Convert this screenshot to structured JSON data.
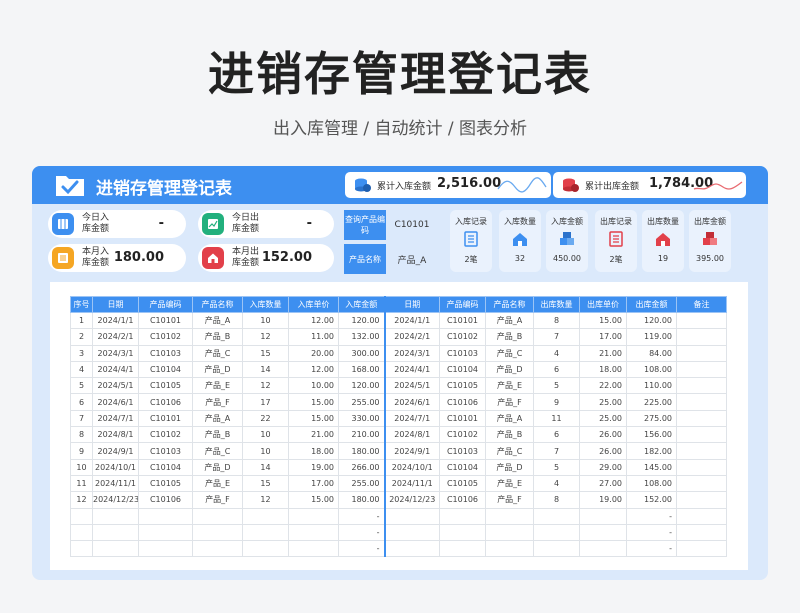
{
  "hero": {
    "title": "进销存管理登记表",
    "subtitle": "出入库管理 / 自动统计 / 图表分析"
  },
  "header": {
    "title": "进销存管理登记表",
    "in_total": {
      "label": "累计入库金额",
      "value": "2,516.00"
    },
    "out_total": {
      "label": "累计出库金额",
      "value": "1,784.00"
    }
  },
  "kpis": {
    "today_in": {
      "label": "今日入库金额",
      "value": "-"
    },
    "today_out": {
      "label": "今日出库金额",
      "value": "-"
    },
    "month_in": {
      "label": "本月入库金额",
      "value": "180.00"
    },
    "month_out": {
      "label": "本月出库金额",
      "value": "152.00"
    }
  },
  "query": {
    "code_label": "查询产品编码",
    "code_value": "C10101",
    "name_label": "产品名称",
    "name_value": "产品_A"
  },
  "stats": [
    {
      "label": "入库记录",
      "value": "2笔",
      "icon": "list-icon"
    },
    {
      "label": "入库数量",
      "value": "32",
      "icon": "home-icon"
    },
    {
      "label": "入库金额",
      "value": "450.00",
      "icon": "boxes-icon"
    },
    {
      "label": "出库记录",
      "value": "2笔",
      "icon": "list-icon"
    },
    {
      "label": "出库数量",
      "value": "19",
      "icon": "home-icon"
    },
    {
      "label": "出库金额",
      "value": "395.00",
      "icon": "boxes-icon"
    }
  ],
  "colors": {
    "accent": "#3d8ff0",
    "out_accent": "#e2404a"
  },
  "table": {
    "headers": [
      "序号",
      "日期",
      "产品编码",
      "产品名称",
      "入库数量",
      "入库单价",
      "入库金额",
      "日期",
      "产品编码",
      "产品名称",
      "出库数量",
      "出库单价",
      "出库金额",
      "备注"
    ],
    "rows": [
      [
        "1",
        "2024/1/1",
        "C10101",
        "产品_A",
        "10",
        "12.00",
        "120.00",
        "2024/1/1",
        "C10101",
        "产品_A",
        "8",
        "15.00",
        "120.00",
        ""
      ],
      [
        "2",
        "2024/2/1",
        "C10102",
        "产品_B",
        "12",
        "11.00",
        "132.00",
        "2024/2/1",
        "C10102",
        "产品_B",
        "7",
        "17.00",
        "119.00",
        ""
      ],
      [
        "3",
        "2024/3/1",
        "C10103",
        "产品_C",
        "15",
        "20.00",
        "300.00",
        "2024/3/1",
        "C10103",
        "产品_C",
        "4",
        "21.00",
        "84.00",
        ""
      ],
      [
        "4",
        "2024/4/1",
        "C10104",
        "产品_D",
        "14",
        "12.00",
        "168.00",
        "2024/4/1",
        "C10104",
        "产品_D",
        "6",
        "18.00",
        "108.00",
        ""
      ],
      [
        "5",
        "2024/5/1",
        "C10105",
        "产品_E",
        "12",
        "10.00",
        "120.00",
        "2024/5/1",
        "C10105",
        "产品_E",
        "5",
        "22.00",
        "110.00",
        ""
      ],
      [
        "6",
        "2024/6/1",
        "C10106",
        "产品_F",
        "17",
        "15.00",
        "255.00",
        "2024/6/1",
        "C10106",
        "产品_F",
        "9",
        "25.00",
        "225.00",
        ""
      ],
      [
        "7",
        "2024/7/1",
        "C10101",
        "产品_A",
        "22",
        "15.00",
        "330.00",
        "2024/7/1",
        "C10101",
        "产品_A",
        "11",
        "25.00",
        "275.00",
        ""
      ],
      [
        "8",
        "2024/8/1",
        "C10102",
        "产品_B",
        "10",
        "21.00",
        "210.00",
        "2024/8/1",
        "C10102",
        "产品_B",
        "6",
        "26.00",
        "156.00",
        ""
      ],
      [
        "9",
        "2024/9/1",
        "C10103",
        "产品_C",
        "10",
        "18.00",
        "180.00",
        "2024/9/1",
        "C10103",
        "产品_C",
        "7",
        "26.00",
        "182.00",
        ""
      ],
      [
        "10",
        "2024/10/1",
        "C10104",
        "产品_D",
        "14",
        "19.00",
        "266.00",
        "2024/10/1",
        "C10104",
        "产品_D",
        "5",
        "29.00",
        "145.00",
        ""
      ],
      [
        "11",
        "2024/11/1",
        "C10105",
        "产品_E",
        "15",
        "17.00",
        "255.00",
        "2024/11/1",
        "C10105",
        "产品_E",
        "4",
        "27.00",
        "108.00",
        ""
      ],
      [
        "12",
        "2024/12/23",
        "C10106",
        "产品_F",
        "12",
        "15.00",
        "180.00",
        "2024/12/23",
        "C10106",
        "产品_F",
        "8",
        "19.00",
        "152.00",
        ""
      ],
      [
        "",
        "",
        "",
        "",
        "",
        "",
        "-",
        "",
        "",
        "",
        "",
        "",
        "-",
        ""
      ],
      [
        "",
        "",
        "",
        "",
        "",
        "",
        "-",
        "",
        "",
        "",
        "",
        "",
        "-",
        ""
      ],
      [
        "",
        "",
        "",
        "",
        "",
        "",
        "-",
        "",
        "",
        "",
        "",
        "",
        "-",
        ""
      ]
    ]
  }
}
